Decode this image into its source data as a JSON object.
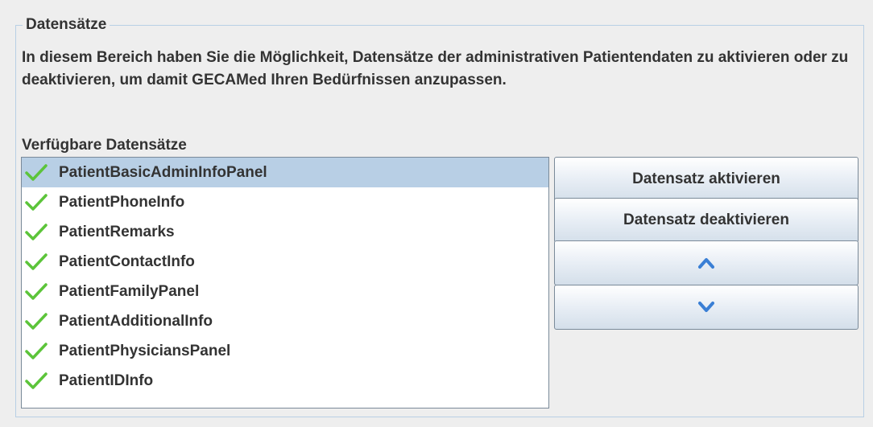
{
  "panel": {
    "title": "Datensätze",
    "description": "In diesem Bereich haben Sie die Möglichkeit, Datensätze der administrativen Patientendaten zu aktivieren oder zu deaktivieren, um damit GECAMed Ihren Bedürfnissen anzupassen."
  },
  "list": {
    "label": "Verfügbare Datensätze",
    "items": [
      {
        "label": "PatientBasicAdminInfoPanel",
        "icon": "check-icon",
        "selected": true
      },
      {
        "label": "PatientPhoneInfo",
        "icon": "check-icon"
      },
      {
        "label": "PatientRemarks",
        "icon": "check-icon"
      },
      {
        "label": "PatientContactInfo",
        "icon": "check-icon"
      },
      {
        "label": "PatientFamilyPanel",
        "icon": "check-icon"
      },
      {
        "label": "PatientAdditionalInfo",
        "icon": "check-icon"
      },
      {
        "label": "PatientPhysiciansPanel",
        "icon": "check-icon"
      },
      {
        "label": "PatientIDInfo",
        "icon": "check-icon"
      }
    ]
  },
  "buttons": {
    "activate_label": "Datensatz aktivieren",
    "deactivate_label": "Datensatz deaktivieren",
    "up_icon": "chevron-up-icon",
    "down_icon": "chevron-down-icon"
  },
  "colors": {
    "selection": "#b8cfe5",
    "border": "#b8cfe5",
    "check": "#5cc43a",
    "arrow": "#3a7fd5",
    "text": "#333333"
  }
}
